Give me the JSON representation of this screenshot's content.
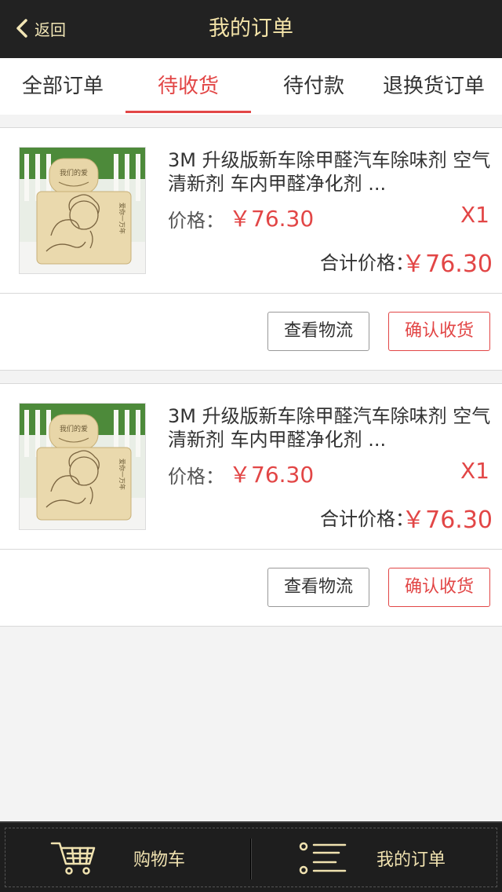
{
  "header": {
    "back_label": "返回",
    "title": "我的订单"
  },
  "tabs": [
    {
      "label": "全部订单",
      "active": false
    },
    {
      "label": "待收货",
      "active": true
    },
    {
      "label": "待付款",
      "active": false
    },
    {
      "label": "退换货订单",
      "active": false
    }
  ],
  "orders": [
    {
      "name": "3M 升级版新车除甲醛汽车除味剂 空气清新剂 车内甲醛净化剂 ...",
      "price_label": "价格：",
      "price": "￥76.30",
      "qty": "X1",
      "total_label": "合计价格：",
      "total": "￥76.30",
      "logistics_label": "查看物流",
      "confirm_label": "确认收货",
      "image_caption_top": "我们的爱",
      "image_caption_side": "爱你一万年"
    },
    {
      "name": "3M 升级版新车除甲醛汽车除味剂 空气清新剂 车内甲醛净化剂 ...",
      "price_label": "价格：",
      "price": "￥76.30",
      "qty": "X1",
      "total_label": "合计价格：",
      "total": "￥76.30",
      "logistics_label": "查看物流",
      "confirm_label": "确认收货",
      "image_caption_top": "我们的爱",
      "image_caption_side": "爱你一万年"
    }
  ],
  "bottom_nav": {
    "cart_label": "购物车",
    "orders_label": "我的订单"
  },
  "colors": {
    "header_bg": "#222222",
    "accent_gold": "#f3e3a8",
    "accent_red": "#e24646",
    "page_bg": "#f3f3f3"
  },
  "icons": {
    "back": "chevron-left-icon",
    "cart": "shopping-cart-icon",
    "orders": "order-list-icon"
  }
}
